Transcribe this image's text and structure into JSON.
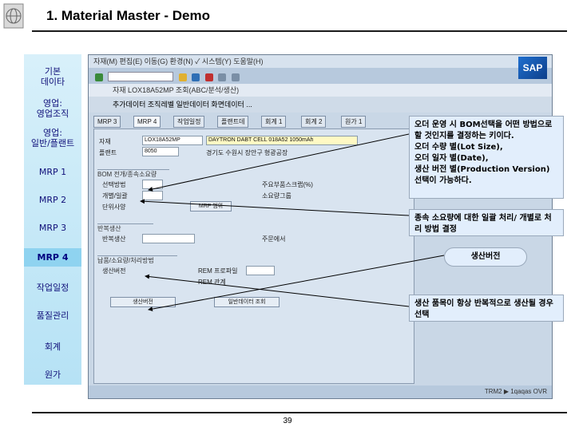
{
  "header": {
    "title": "1. Material Master - Demo"
  },
  "nav": {
    "items": [
      {
        "label": "기본\n데이타"
      },
      {
        "label": "영업:\n영업조직"
      },
      {
        "label": "영업:\n일반/플랜트"
      },
      {
        "label": "MRP 1"
      },
      {
        "label": "MRP 2"
      },
      {
        "label": "MRP 3"
      },
      {
        "label": "MRP 4"
      },
      {
        "label": "작업일정"
      },
      {
        "label": "품질관리"
      },
      {
        "label": "회계"
      },
      {
        "label": "원가"
      }
    ]
  },
  "sap": {
    "menubar": "자재(M)  편집(E)  이동(G)  환경(N)  ✓ 시스템(Y)  도움말(H)",
    "titlebar": "자재 LOX18A52MP 조회(ABC/분석/생산)",
    "apptool": "추가데이터   조직레벨   일반데이터   화면데이터 ...",
    "logo": "SAP",
    "tabs": [
      "MRP 3",
      "MRP 4",
      "작업일정",
      "플랜트데",
      "회계 1",
      "회계 2",
      "원가 1"
    ],
    "fields": {
      "material_label": "자재",
      "material_value": "LOX18A52MP",
      "material_desc": "DAYTRON DABT CELL 018A52 1050mAh",
      "plant_label": "플랜트",
      "plant_value": "8050",
      "plant_desc": "경기도 수원시 장안구 형광공장"
    },
    "groups": {
      "bom": "BOM 전개/종속소요량",
      "sel_method": "선택방법",
      "indiv_coll": "개별/일괄",
      "unit_spec": "단위사양",
      "repetitive": "반복생산",
      "prod_ver": "생산버전",
      "storage": "납품/소요량/처리방법"
    },
    "labels": {
      "mrp_type": "주요부품스크랩(%)",
      "mrp_ctrl": "소요량그룹",
      "rep_profile": "REM 프로파일",
      "action_ctrl": "주문에서",
      "rep_mfg": "반복생산",
      "rep_prof_val": "REM 관계"
    },
    "buttons": {
      "prod_versions": "생산버전",
      "mrp_area": "MRP 범위",
      "master": "일반데이터 조회"
    },
    "status": "TRM2  ▶ 1qaqas  OVR"
  },
  "annotations": [
    {
      "text": "오더 운영 시 BOM선택을 어떤 방법으로 할 것인지를 결정하는 키이다.\n오더 수량 별(Lot Size),\n오더 일자 별(Date),\n생산 버전 별(Production Version) 선택이 가능하다."
    },
    {
      "text": "종속 소요량에 대한 일괄 처리/ 개별로 처리 방법 결정"
    },
    {
      "text": "생산버전"
    },
    {
      "text": "생산 품목이 항상 반복적으로 생산될 경우 선택"
    }
  ],
  "footer": {
    "page": "39"
  },
  "colors": {
    "accent": "#8fd3f0",
    "nav_text": "#10107a",
    "sap_blue": "#c9d7e6"
  }
}
